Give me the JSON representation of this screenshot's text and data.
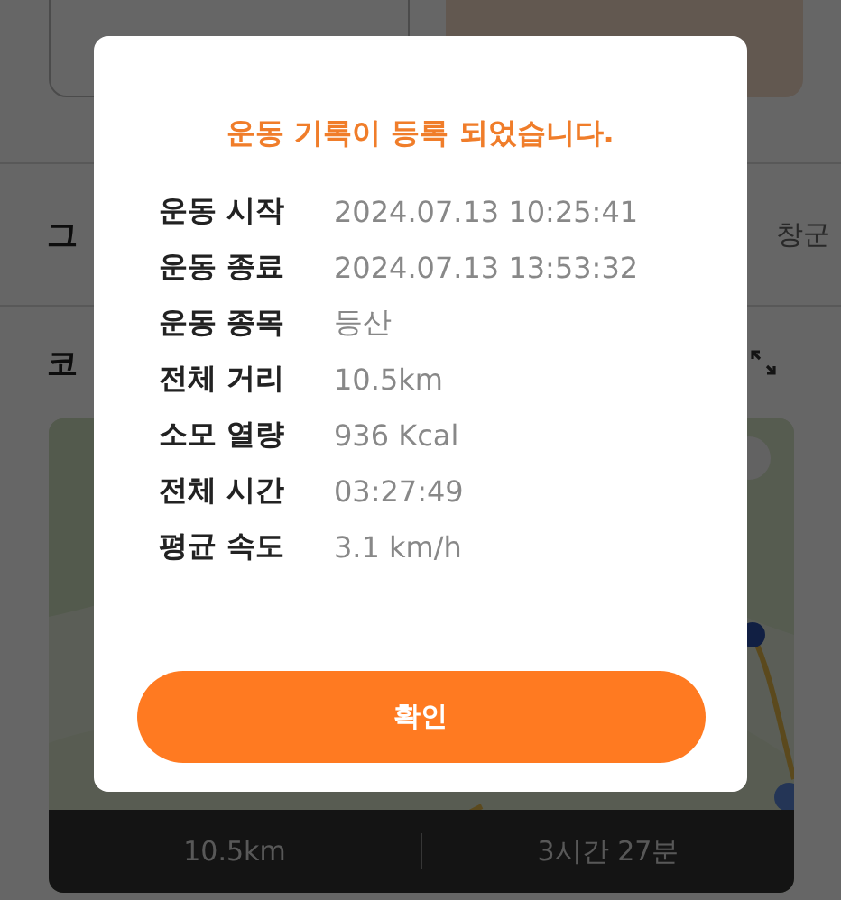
{
  "screen": {
    "weather_label": "그",
    "region": "창군",
    "course_label": "코",
    "summary": {
      "distance": "10.5km",
      "duration": "3시간 27분"
    }
  },
  "dialog": {
    "title": "운동 기록이 등록 되었습니다.",
    "rows": [
      {
        "label": "운동 시작",
        "value": "2024.07.13 10:25:41"
      },
      {
        "label": "운동 종료",
        "value": "2024.07.13 13:53:32"
      },
      {
        "label": "운동 종목",
        "value": "등산"
      },
      {
        "label": "전체 거리",
        "value": "10.5km"
      },
      {
        "label": "소모 열량",
        "value": "936 Kcal"
      },
      {
        "label": "전체 시간",
        "value": "03:27:49"
      },
      {
        "label": "평균 속도",
        "value": "3.1 km/h"
      }
    ],
    "button": "확인"
  }
}
